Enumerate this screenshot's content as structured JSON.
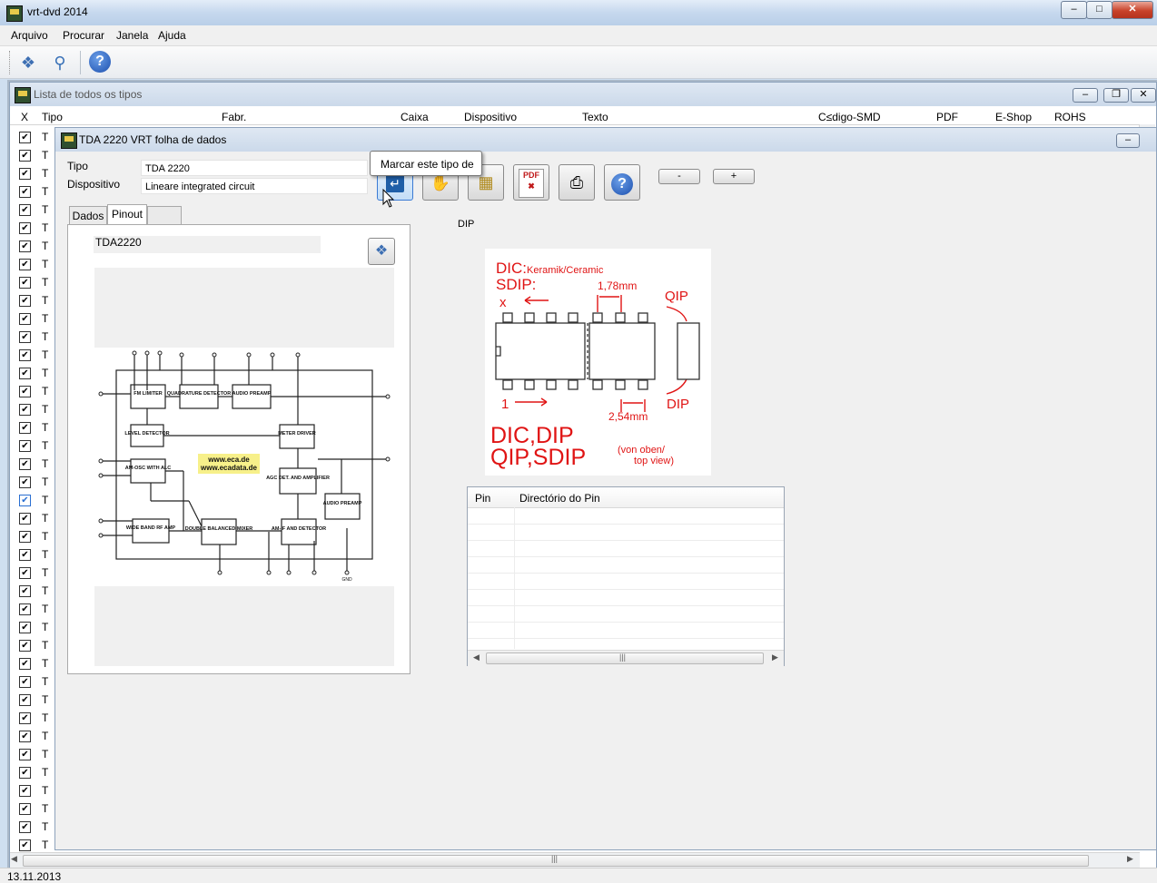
{
  "window": {
    "title": "vrt-dvd 2014"
  },
  "menu": [
    "Arquivo",
    "Procurar",
    "Janela",
    "Ajuda"
  ],
  "list_window": {
    "title": "Lista de todos os tipos",
    "columns": [
      "X",
      "Tipo",
      "Fabr.",
      "Caixa",
      "Dispositivo",
      "Texto",
      "C≤digo-SMD",
      "PDF",
      "E-Shop",
      "ROHS"
    ],
    "row_type_prefix": "T"
  },
  "datasheet": {
    "title": "TDA 2220 VRT folha de dados",
    "tipo_label": "Tipo",
    "tipo_value": "TDA 2220",
    "dispositivo_label": "Dispositivo",
    "dispositivo_value": "Lineare integrated circuit",
    "tooltip": "Marcar este tipo de",
    "minus_label": "-",
    "plus_label": "+",
    "tabs": [
      "Dados",
      "Pinout",
      ""
    ],
    "part_name": "TDA2220",
    "package_label": "DIP",
    "block_diagram": {
      "blocks": [
        "FM LIMITER",
        "QUADRATURE DETECTOR",
        "AUDIO PREAMP",
        "LEVEL DETECTOR",
        "METER DRIVER",
        "AM-OSC WITH ALC",
        "AGC DET. AND AMPLIFIER",
        "AUDIO PREAMP",
        "WIDE BAND RF AMP",
        "DOUBLE BALANCED MIXER",
        "AM-IF AND DETECTOR"
      ],
      "watermark": [
        "www.eca.de",
        "www.ecadata.de"
      ],
      "gnd_label": "GND"
    },
    "pinout_image": {
      "title": "DIC:",
      "title_sub": "Keramik/Ceramic",
      "sdip": "SDIP:",
      "x_label": "x",
      "pitch_sdip": "1,78mm",
      "qip": "QIP",
      "dip": "DIP",
      "one": "1",
      "pitch_dip": "2,54mm",
      "line1": "DIC,DIP",
      "line2": "QIP,SDIP",
      "note1": "(von oben/",
      "note2": "top view)"
    },
    "pin_table": {
      "col1": "Pin",
      "col2": "Directório do Pin"
    }
  },
  "status": {
    "date": "13.11.2013"
  }
}
